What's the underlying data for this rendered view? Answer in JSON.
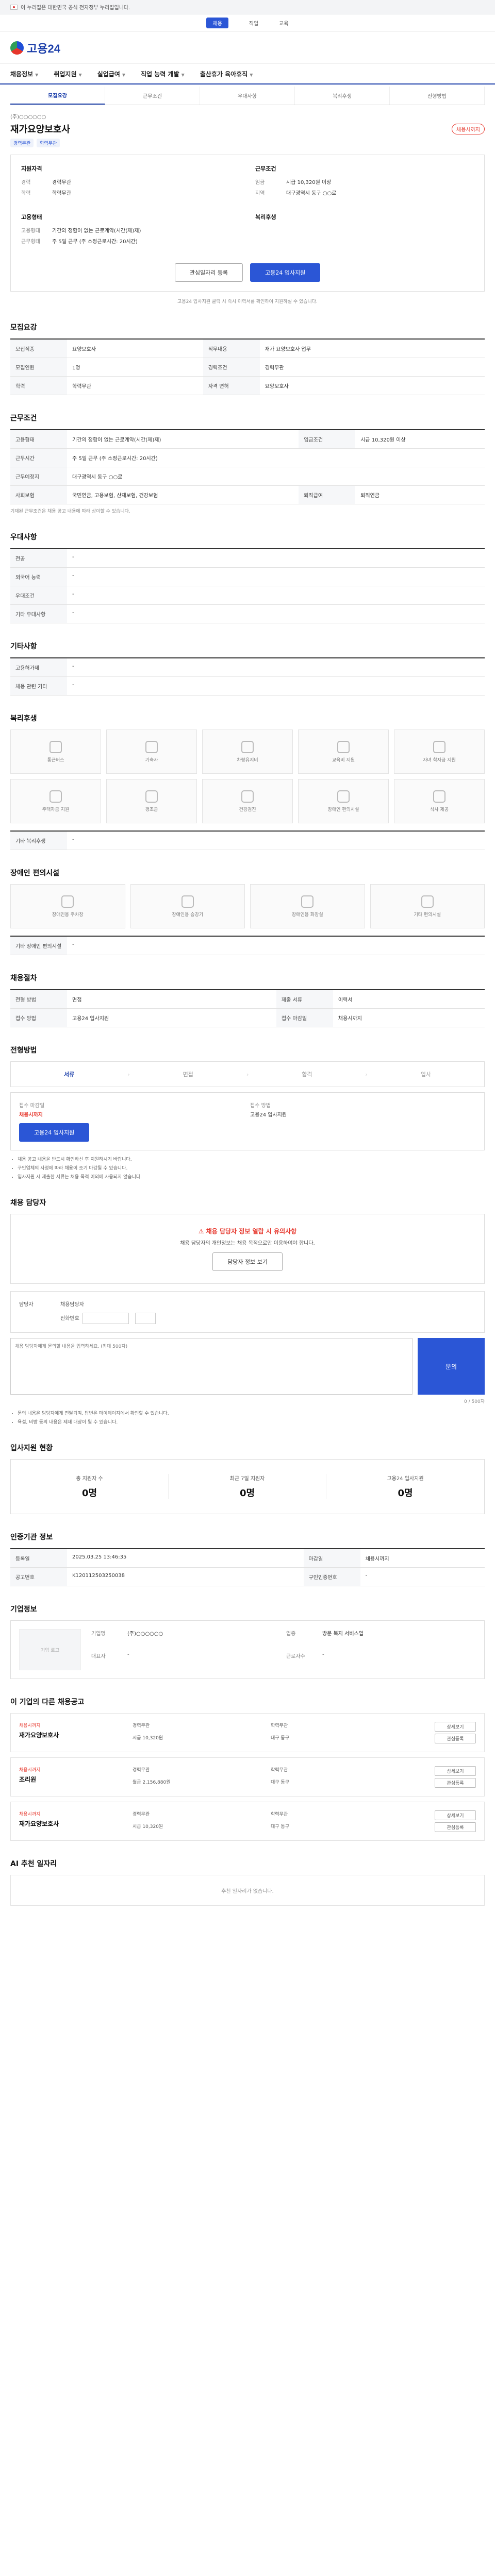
{
  "gov_banner": "이 누리집은 대한민국 공식 전자정부 누리집입니다.",
  "top_strip": [
    "채용",
    "직업",
    "교육"
  ],
  "brand": "고용24",
  "gnb": [
    "채용정보",
    "취업지원",
    "실업급여",
    "직업 능력 개발",
    "출산휴가 육아휴직"
  ],
  "tabs": [
    "모집요강",
    "근무조건",
    "우대사항",
    "복리후생",
    "전형방법"
  ],
  "company_name": "(주)○○○○○○",
  "job_title": "재가요양보호사",
  "closing_badge": "채용시까지",
  "badges": [
    "경력무관",
    "학력무관"
  ],
  "summary": {
    "left_title": "지원자격",
    "left_rows": [
      {
        "k": "경력",
        "v": "경력무관"
      },
      {
        "k": "학력",
        "v": "학력무관"
      }
    ],
    "right_title": "근무조건",
    "right_rows": [
      {
        "k": "임금",
        "v": "시급 10,320원 이상"
      },
      {
        "k": "지역",
        "v": "대구광역시 동구 ○○로"
      }
    ],
    "left2_title": "고용형태",
    "left2_rows": [
      {
        "k": "고용형태",
        "v": "기간의 정함이 없는 근로계약(시간(제)제)"
      },
      {
        "k": "근무형태",
        "v": "주 5일 근무 (주 소정근로시간: 20시간)"
      }
    ],
    "right2_title": "복리후생",
    "right2_rows": []
  },
  "buttons": {
    "scrap": "관심일자리 등록",
    "apply": "고용24 입사지원"
  },
  "apply_note": "고용24 입사지원 클릭 시 즉시 이력서를 확인하여 지원하실 수 있습니다.",
  "recruit": {
    "title": "모집요강",
    "rows": [
      {
        "k": "모집직종",
        "v": "요양보호사"
      },
      {
        "k": "직무내용",
        "v": "재가 요양보호사 업무"
      },
      {
        "k": "모집인원",
        "v": "1명"
      },
      {
        "k": "경력조건",
        "v": "경력무관"
      },
      {
        "k": "학력",
        "v": "학력무관"
      },
      {
        "k": "자격 면허",
        "v": "요양보호사"
      }
    ]
  },
  "conditions": {
    "title": "근무조건",
    "rows": [
      {
        "k": "고용형태",
        "v": "기간의 정함이 없는 근로계약(시간(제)제)"
      },
      {
        "k": "임금조건",
        "v": "시급 10,320원 이상"
      },
      {
        "k": "근무시간",
        "v": "주 5일 근무 (주 소정근로시간: 20시간)"
      },
      {
        "k": "근무예정지",
        "v": "대구광역시 동구 ○○로"
      },
      {
        "k": "사회보험",
        "v": "국민연금, 고용보험, 산재보험, 건강보험"
      },
      {
        "k": "퇴직급여",
        "v": "퇴직연금"
      }
    ],
    "note": "기재된 근무조건은 채용 공고 내용에 따라 상이할 수 있습니다."
  },
  "preference": {
    "title": "우대사항",
    "rows": [
      {
        "k": "전공",
        "v": "-"
      },
      {
        "k": "외국어 능력",
        "v": "-"
      },
      {
        "k": "우대조건",
        "v": "-"
      },
      {
        "k": "기타 우대사항",
        "v": "-"
      }
    ]
  },
  "other": {
    "title": "기타사항",
    "rows": [
      {
        "k": "고용허가제",
        "v": "-"
      },
      {
        "k": "채용 관련 기타",
        "v": "-"
      }
    ]
  },
  "welfare": {
    "title": "복리후생",
    "items": [
      "통근버스",
      "기숙사",
      "차량유지비",
      "교육비 지원",
      "자녀 학자금 지원",
      "주택자금 지원",
      "경조금",
      "건강검진",
      "장애인 편의시설",
      "식사 제공"
    ],
    "extra_k": "기타 복리후생",
    "extra_v": "-"
  },
  "disability": {
    "title": "장애인 편의시설",
    "items": [
      "장애인용 주차장",
      "장애인용 승강기",
      "장애인용 화장실",
      "기타 편의시설"
    ],
    "extra_k": "기타 장애인 편의시설",
    "extra_v": "-"
  },
  "process": {
    "title": "채용절차",
    "rows": [
      {
        "k": "전형 방법",
        "v": "면접"
      },
      {
        "k": "제출 서류",
        "v": "이력서"
      },
      {
        "k": "접수 방법",
        "v": "고용24 입사지원"
      },
      {
        "k": "접수 마감일",
        "v": "채용시까지"
      }
    ]
  },
  "steps": {
    "title": "전형방법",
    "labels": [
      "서류",
      "면접",
      "합격",
      "입사"
    ],
    "box": [
      {
        "k": "접수 마감일",
        "v": "채용시까지"
      },
      {
        "k": "접수 방법",
        "v": "고용24 입사지원"
      }
    ],
    "apply_btn": "고용24 입사지원",
    "bullets": [
      "채용 공고 내용을 반드시 확인하신 후 지원하시기 바랍니다.",
      "구인업체의 사정에 따라 채용이 조기 마감될 수 있습니다.",
      "입사지원 시 제출한 서류는 채용 목적 이외에 사용되지 않습니다."
    ]
  },
  "counselor": {
    "title": "채용 담당자",
    "warn_title": "채용 담당자 정보 열람 시 유의사항",
    "warn_text": "채용 담당자의 개인정보는 채용 목적으로만 이용하여야 합니다.",
    "btn": "담당자 정보 보기",
    "name_k": "담당자",
    "name_v": "채용담당자",
    "phone_k": "전화번호",
    "textarea_ph": "채용 담당자에게 문의할 내용을 입력하세요. (최대 500자)",
    "send": "문의",
    "count": "0 / 500자",
    "bullets": [
      "문의 내용은 담당자에게 전달되며, 답변은 마이페이지에서 확인할 수 있습니다.",
      "욕설, 비방 등의 내용은 제재 대상이 될 수 있습니다."
    ]
  },
  "stats": {
    "title": "입사지원 현황",
    "items": [
      {
        "label": "총 지원자 수",
        "value": "0명"
      },
      {
        "label": "최근 7일 지원자",
        "value": "0명"
      },
      {
        "label": "고용24 입사지원",
        "value": "0명"
      }
    ]
  },
  "posting": {
    "title": "인증기관 정보",
    "rows": [
      {
        "k": "등록일",
        "v": "2025.03.25 13:46:35"
      },
      {
        "k": "마감일",
        "v": "채용시까지"
      },
      {
        "k": "공고번호",
        "v": "K120112503250038"
      },
      {
        "k": "구인인증번호",
        "v": "-"
      }
    ]
  },
  "org": {
    "title": "기업정보",
    "img": "기업 로고",
    "rows": [
      {
        "k": "기업명",
        "v": "(주)○○○○○○"
      },
      {
        "k": "업종",
        "v": "방문 복지 서비스업"
      },
      {
        "k": "대표자",
        "v": "-"
      },
      {
        "k": "근로자수",
        "v": "-"
      }
    ]
  },
  "related": {
    "title": "이 기업의 다른 채용공고",
    "cards": [
      {
        "tag": "채용시까지",
        "title": "재가요양보호사",
        "c1": "경력무관",
        "c2": "학력무관",
        "c3": "시급 10,320원",
        "c4": "대구 동구"
      },
      {
        "tag": "채용시까지",
        "title": "조리원",
        "c1": "경력무관",
        "c2": "학력무관",
        "c3": "월급 2,156,880원",
        "c4": "대구 동구"
      },
      {
        "tag": "채용시까지",
        "title": "재가요양보호사",
        "c1": "경력무관",
        "c2": "학력무관",
        "c3": "시급 10,320원",
        "c4": "대구 동구"
      }
    ],
    "btn_detail": "상세보기",
    "btn_scrap": "관심등록"
  },
  "recommend": {
    "title": "AI 추천 일자리",
    "empty": "추천 일자리가 없습니다."
  }
}
